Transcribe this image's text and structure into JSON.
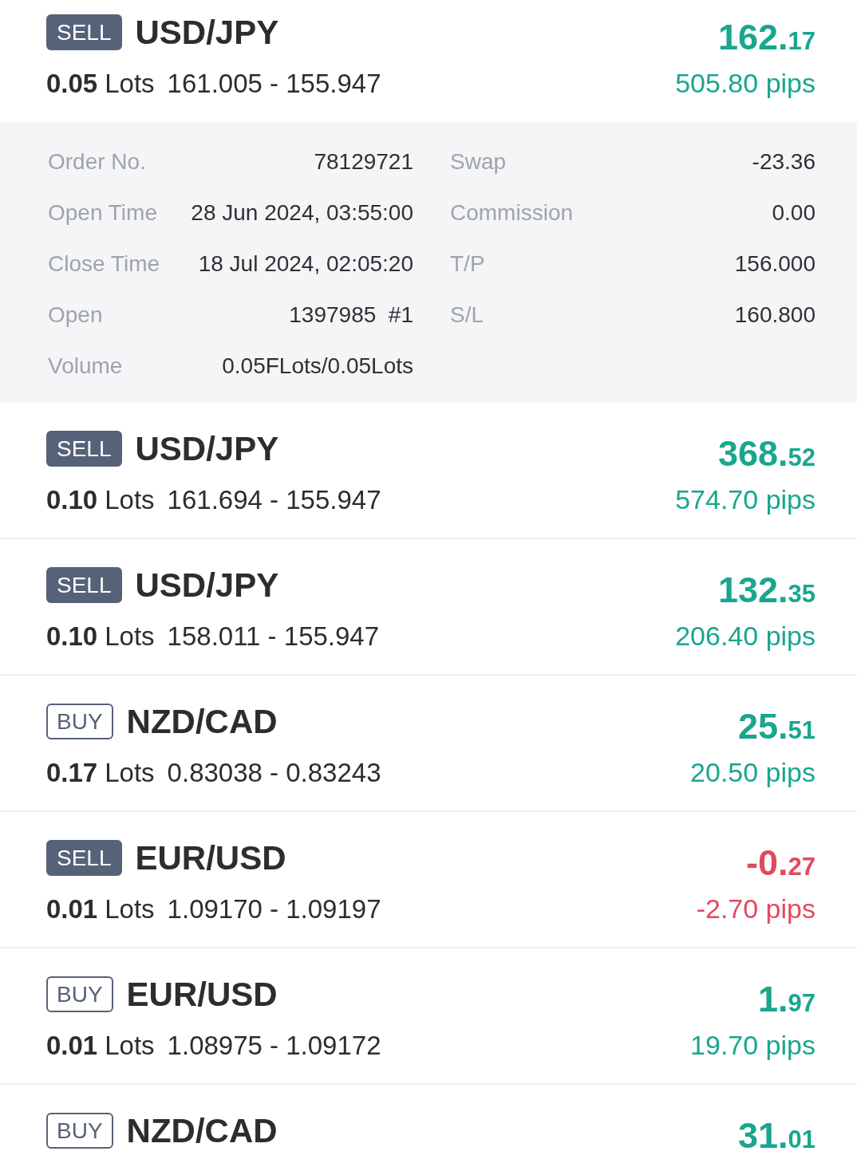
{
  "trades": [
    {
      "side": {
        "label": "SELL",
        "kind": "sell"
      },
      "symbol": "USD/JPY",
      "lots": "0.05",
      "lots_unit": "Lots",
      "prices": "161.005 - 155.947",
      "profit": {
        "whole": "162.",
        "decimals": "17"
      },
      "pips": "505.80 pips",
      "color": "#19a68e",
      "expanded": true,
      "details": {
        "left": [
          {
            "label": "Order No.",
            "value": "78129721"
          },
          {
            "label": "Open Time",
            "value": "28 Jun 2024, 03:55:00"
          },
          {
            "label": "Close Time",
            "value": "18 Jul 2024, 02:05:20"
          },
          {
            "label": "Open",
            "value": "1397985  #1"
          },
          {
            "label": "Volume",
            "value": "0.05FLots/0.05Lots"
          }
        ],
        "right": [
          {
            "label": "Swap",
            "value": "-23.36"
          },
          {
            "label": "Commission",
            "value": "0.00"
          },
          {
            "label": "T/P",
            "value": "156.000"
          },
          {
            "label": "S/L",
            "value": "160.800"
          }
        ]
      }
    },
    {
      "side": {
        "label": "SELL",
        "kind": "sell"
      },
      "symbol": "USD/JPY",
      "lots": "0.10",
      "lots_unit": "Lots",
      "prices": "161.694 - 155.947",
      "profit": {
        "whole": "368.",
        "decimals": "52"
      },
      "pips": "574.70 pips",
      "color": "#19a68e",
      "expanded": false
    },
    {
      "side": {
        "label": "SELL",
        "kind": "sell"
      },
      "symbol": "USD/JPY",
      "lots": "0.10",
      "lots_unit": "Lots",
      "prices": "158.011 - 155.947",
      "profit": {
        "whole": "132.",
        "decimals": "35"
      },
      "pips": "206.40 pips",
      "color": "#19a68e",
      "expanded": false
    },
    {
      "side": {
        "label": "BUY",
        "kind": "buy"
      },
      "symbol": "NZD/CAD",
      "lots": "0.17",
      "lots_unit": "Lots",
      "prices": "0.83038 - 0.83243",
      "profit": {
        "whole": "25.",
        "decimals": "51"
      },
      "pips": "20.50 pips",
      "color": "#19a68e",
      "expanded": false
    },
    {
      "side": {
        "label": "SELL",
        "kind": "sell"
      },
      "symbol": "EUR/USD",
      "lots": "0.01",
      "lots_unit": "Lots",
      "prices": "1.09170 - 1.09197",
      "profit": {
        "whole": "-0.",
        "decimals": "27"
      },
      "pips": "-2.70 pips",
      "color": "#e2495e",
      "expanded": false
    },
    {
      "side": {
        "label": "BUY",
        "kind": "buy"
      },
      "symbol": "EUR/USD",
      "lots": "0.01",
      "lots_unit": "Lots",
      "prices": "1.08975 - 1.09172",
      "profit": {
        "whole": "1.",
        "decimals": "97"
      },
      "pips": "19.70 pips",
      "color": "#19a68e",
      "expanded": false
    },
    {
      "side": {
        "label": "BUY",
        "kind": "buy"
      },
      "symbol": "NZD/CAD",
      "profit": {
        "whole": "31.",
        "decimals": "01"
      },
      "color": "#19a68e",
      "expanded": false
    }
  ]
}
